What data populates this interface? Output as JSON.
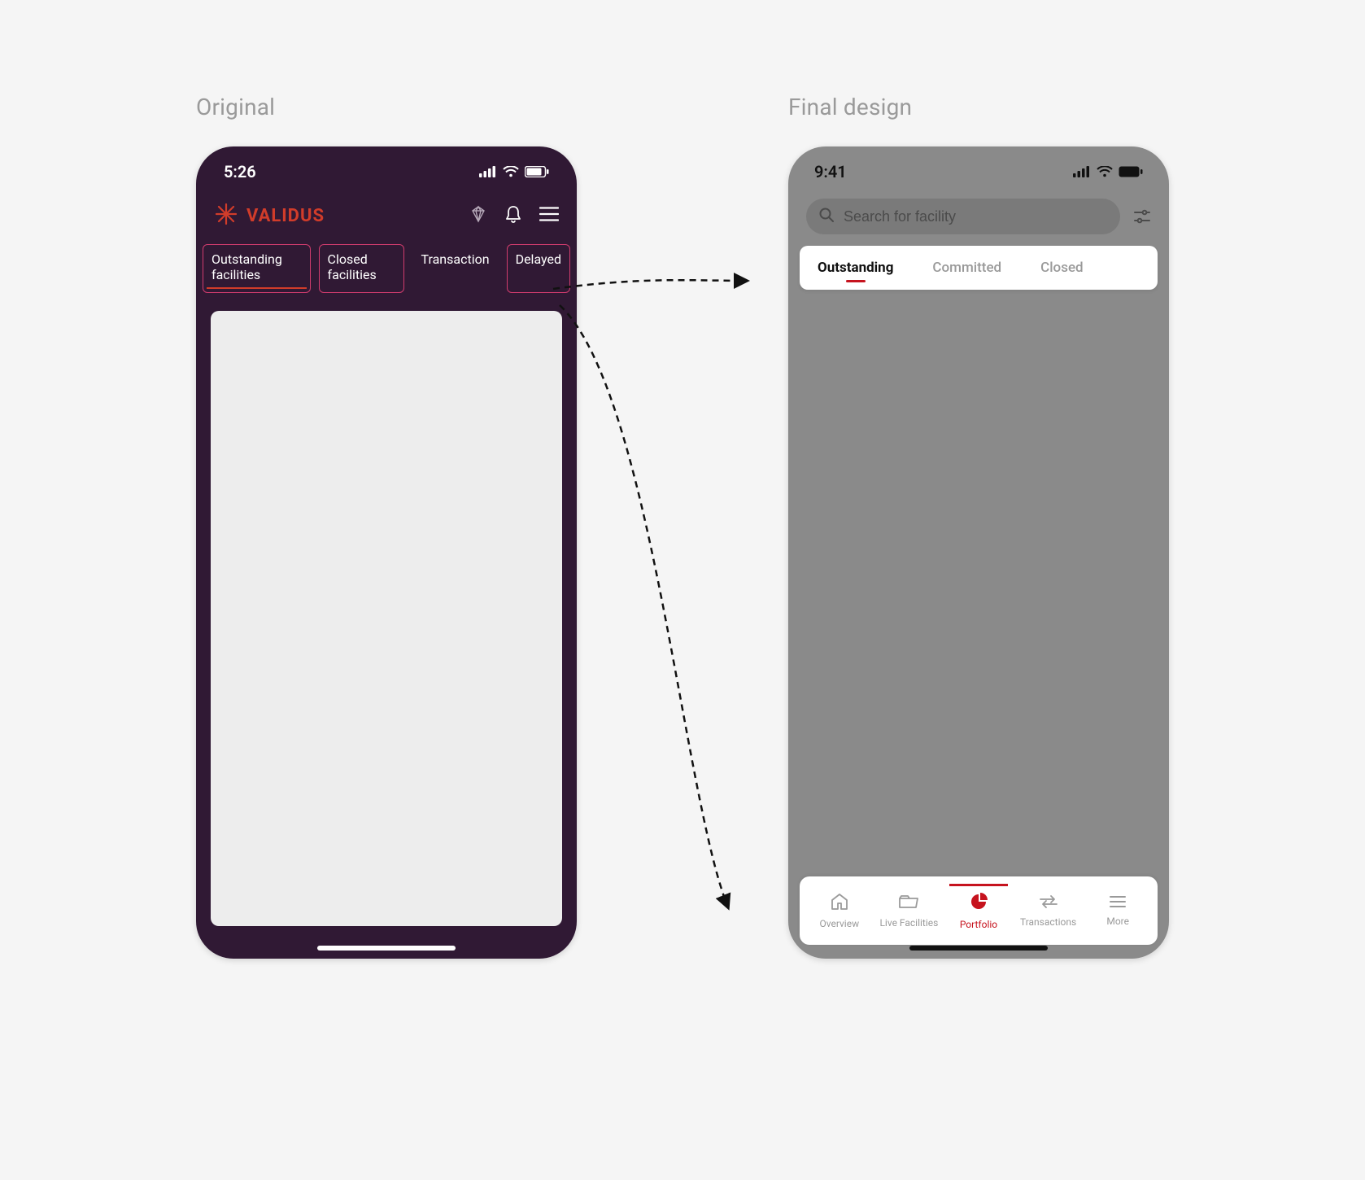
{
  "labels": {
    "original": "Original",
    "final": "Final design"
  },
  "original": {
    "status_time": "5:26",
    "brand": "VALIDUS",
    "tabs": {
      "outstanding": "Outstanding facilities",
      "closed": "Closed facilities",
      "transaction": "Transaction",
      "delayed": "Delayed"
    }
  },
  "final": {
    "status_time": "9:41",
    "search": {
      "placeholder": "Search for facility"
    },
    "tabs": {
      "outstanding": "Outstanding",
      "committed": "Committed",
      "closed": "Closed"
    },
    "bottom_nav": {
      "overview": "Overview",
      "live_facilities": "Live Facilities",
      "portfolio": "Portfolio",
      "transactions": "Transactions",
      "more": "More"
    }
  }
}
